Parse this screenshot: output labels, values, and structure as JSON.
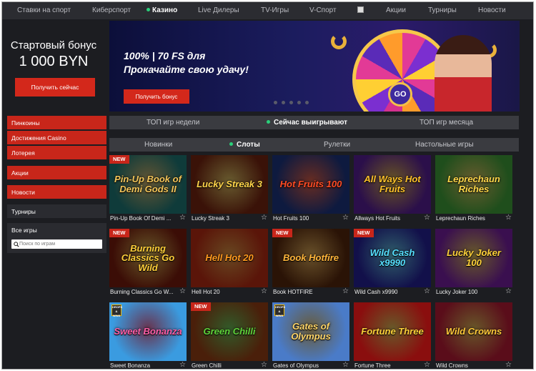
{
  "topnav": {
    "items": [
      {
        "label": "Ставки на спорт"
      },
      {
        "label": "Киберспорт"
      },
      {
        "label": "Казино",
        "active": true
      },
      {
        "label": "Live Дилеры"
      },
      {
        "label": "TV-Игры"
      },
      {
        "label": "V-Спорт"
      },
      {
        "label": "Акции"
      },
      {
        "label": "Турниры"
      },
      {
        "label": "Новости"
      }
    ]
  },
  "sidebar": {
    "bonus_title": "Стартовый бонус",
    "bonus_amount": "1 000 BYN",
    "bonus_button": "Получить сейчас",
    "links": [
      {
        "label": "Пинкоины",
        "style": "red"
      },
      {
        "label": "Достижения Casino",
        "style": "red"
      },
      {
        "label": "Лотерея",
        "style": "red"
      },
      {
        "label": "Акции",
        "style": "red"
      },
      {
        "label": "Новости",
        "style": "red"
      },
      {
        "label": "Турниры",
        "style": "dark"
      }
    ],
    "all_games_label": "Все игры",
    "search_placeholder": "Поиск по играм"
  },
  "banner": {
    "headline": "100% | 70 FS для",
    "subheadline": "Прокачайте свою удачу!",
    "button": "Получить бонус",
    "wheel_center": "GO"
  },
  "primary_tabs": [
    {
      "label": "ТОП игр недели"
    },
    {
      "label": "Сейчас выигрывают",
      "active": true
    },
    {
      "label": "ТОП игр месяца"
    }
  ],
  "category_tabs": [
    {
      "label": "Новинки"
    },
    {
      "label": "Слоты",
      "active": true
    },
    {
      "label": "Рулетки"
    },
    {
      "label": "Настольные игры"
    }
  ],
  "badge_new": "NEW",
  "games": [
    {
      "name": "Pin-Up Book Of Demi ...",
      "art": "Pin-Up Book of Demi Gods II",
      "new": true,
      "bg": "#0f3b3a",
      "fg": "#f2c55a"
    },
    {
      "name": "Lucky Streak 3",
      "art": "Lucky Streak 3",
      "new": false,
      "bg": "#3a1208",
      "fg": "#ffd54a"
    },
    {
      "name": "Hot Fruits 100",
      "art": "Hot Fruits 100",
      "new": false,
      "bg": "#0e1a3f",
      "fg": "#ff4b24"
    },
    {
      "name": "Allways Hot Fruits",
      "art": "All Ways Hot Fruits",
      "new": false,
      "bg": "#2b0f4a",
      "fg": "#ffc22b"
    },
    {
      "name": "Leprechaun Riches",
      "art": "Leprechaun Riches",
      "new": false,
      "bg": "#1f4e1c",
      "fg": "#ffd84a"
    },
    {
      "name": "Burning Classics Go W...",
      "art": "Burning Classics Go Wild",
      "new": true,
      "bg": "#3b0d06",
      "fg": "#ffcf3a"
    },
    {
      "name": "Hell Hot 20",
      "art": "Hell Hot 20",
      "new": false,
      "bg": "#5a1509",
      "fg": "#ff9a1f"
    },
    {
      "name": "Book HOTFIRE",
      "art": "Book Hotfire",
      "new": true,
      "bg": "#2a1306",
      "fg": "#ffb53a"
    },
    {
      "name": "Wild Cash x9990",
      "art": "Wild Cash x9990",
      "new": true,
      "bg": "#12104a",
      "fg": "#56e0ff"
    },
    {
      "name": "Lucky Joker 100",
      "art": "Lucky Joker 100",
      "new": false,
      "bg": "#3a0f4f",
      "fg": "#ffd23a"
    },
    {
      "name": "Sweet Bonanza",
      "art": "Sweet Bonanza",
      "new": false,
      "dw": true,
      "bg": "#3a9be0",
      "fg": "#ff5fa8"
    },
    {
      "name": "Green Chilli",
      "art": "Green Chilli",
      "new": true,
      "bg": "#4a1f0a",
      "fg": "#5fd43a"
    },
    {
      "name": "Gates of Olympus",
      "art": "Gates of Olympus",
      "new": false,
      "dw": true,
      "bg": "#4a7bc8",
      "fg": "#ffd66a"
    },
    {
      "name": "Fortune Three",
      "art": "Fortune Three",
      "new": false,
      "bg": "#8a0e0e",
      "fg": "#ffd23a"
    },
    {
      "name": "Wild Crowns",
      "art": "Wild Crowns",
      "new": false,
      "bg": "#5a0d1a",
      "fg": "#ffc93a"
    }
  ],
  "drops_wins_label": "DROPS & WINS",
  "star_icon": "☆"
}
